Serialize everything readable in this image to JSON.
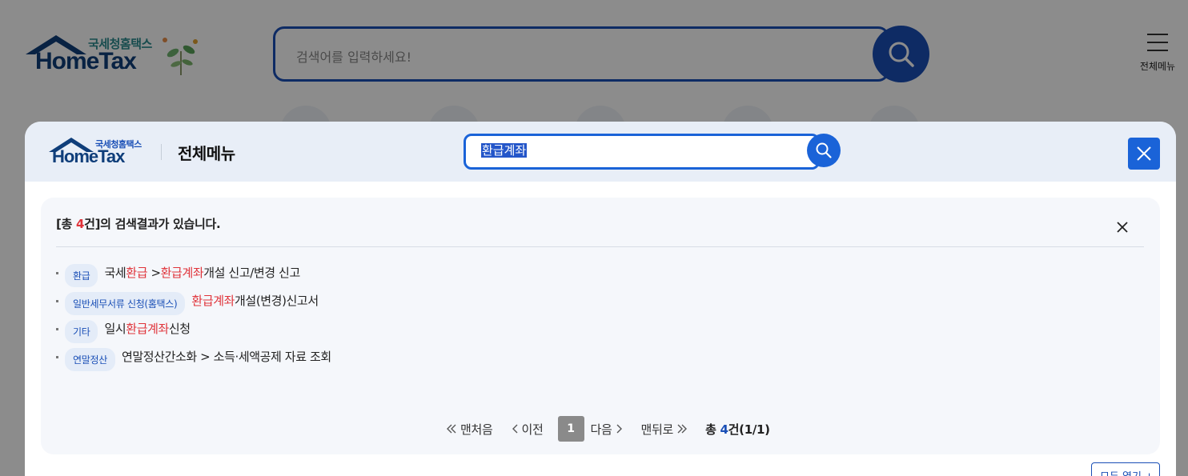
{
  "background": {
    "logo": {
      "brand_kr": "국세청홈택스",
      "brand_en": "HomeTax"
    },
    "search": {
      "placeholder": "검색어를 입력하세요!"
    },
    "menu_label": "전체메뉴"
  },
  "modal": {
    "logo": {
      "brand_kr": "국세청홈택스",
      "brand_en": "HomeTax"
    },
    "title": "전체메뉴",
    "search_value": "환급계좌",
    "result_summary": {
      "prefix": "[총 ",
      "count": "4",
      "suffix": "건]의 검색결과가 있습니다."
    },
    "results": [
      {
        "tag": "환급",
        "parts": [
          {
            "t": "국세",
            "hl": false
          },
          {
            "t": "환급",
            "hl": true
          },
          {
            "t": " >",
            "hl": false
          },
          {
            "t": "환급계좌",
            "hl": true
          },
          {
            "t": "개설 신고/변경 신고",
            "hl": false
          }
        ]
      },
      {
        "tag": "일반세무서류 신청(홈택스)",
        "parts": [
          {
            "t": "환급계좌",
            "hl": true
          },
          {
            "t": "개설(변경)신고서",
            "hl": false
          }
        ]
      },
      {
        "tag": "기타",
        "parts": [
          {
            "t": "일시",
            "hl": false
          },
          {
            "t": "환급계좌",
            "hl": true
          },
          {
            "t": "신청",
            "hl": false
          }
        ]
      },
      {
        "tag": "연말정산",
        "parts": [
          {
            "t": "연말정산간소화 > 소득·세액공제 자료 조회",
            "hl": false
          }
        ]
      }
    ],
    "pager": {
      "first": "맨처음",
      "prev": "이전",
      "current": "1",
      "next": "다음",
      "last": "맨뒤로",
      "total_prefix": "총 ",
      "total_count": "4",
      "total_suffix": "건(1/1)"
    },
    "expand_all": "모두 열기 +"
  },
  "colors": {
    "brand_blue": "#1a4fb6",
    "button_blue": "#1a63d8",
    "highlight_red": "#e0333a",
    "header_bg": "#e8eef7"
  }
}
